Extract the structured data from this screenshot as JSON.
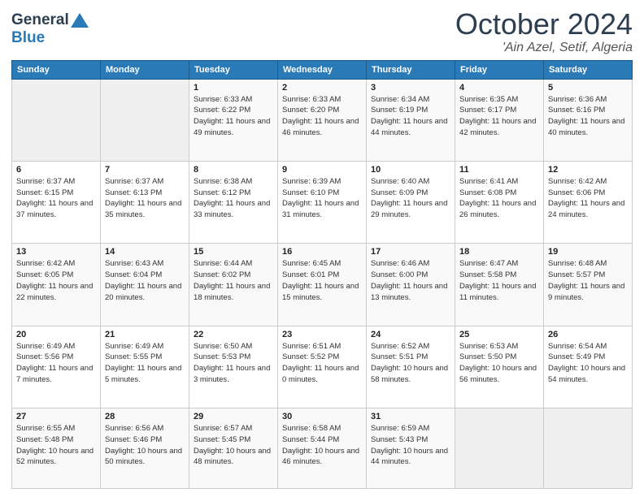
{
  "header": {
    "logo_line1": "General",
    "logo_line2": "Blue",
    "month_title": "October 2024",
    "location": "'Ain Azel, Setif, Algeria"
  },
  "weekdays": [
    "Sunday",
    "Monday",
    "Tuesday",
    "Wednesday",
    "Thursday",
    "Friday",
    "Saturday"
  ],
  "weeks": [
    [
      {
        "day": "",
        "info": ""
      },
      {
        "day": "",
        "info": ""
      },
      {
        "day": "1",
        "info": "Sunrise: 6:33 AM\nSunset: 6:22 PM\nDaylight: 11 hours and 49 minutes."
      },
      {
        "day": "2",
        "info": "Sunrise: 6:33 AM\nSunset: 6:20 PM\nDaylight: 11 hours and 46 minutes."
      },
      {
        "day": "3",
        "info": "Sunrise: 6:34 AM\nSunset: 6:19 PM\nDaylight: 11 hours and 44 minutes."
      },
      {
        "day": "4",
        "info": "Sunrise: 6:35 AM\nSunset: 6:17 PM\nDaylight: 11 hours and 42 minutes."
      },
      {
        "day": "5",
        "info": "Sunrise: 6:36 AM\nSunset: 6:16 PM\nDaylight: 11 hours and 40 minutes."
      }
    ],
    [
      {
        "day": "6",
        "info": "Sunrise: 6:37 AM\nSunset: 6:15 PM\nDaylight: 11 hours and 37 minutes."
      },
      {
        "day": "7",
        "info": "Sunrise: 6:37 AM\nSunset: 6:13 PM\nDaylight: 11 hours and 35 minutes."
      },
      {
        "day": "8",
        "info": "Sunrise: 6:38 AM\nSunset: 6:12 PM\nDaylight: 11 hours and 33 minutes."
      },
      {
        "day": "9",
        "info": "Sunrise: 6:39 AM\nSunset: 6:10 PM\nDaylight: 11 hours and 31 minutes."
      },
      {
        "day": "10",
        "info": "Sunrise: 6:40 AM\nSunset: 6:09 PM\nDaylight: 11 hours and 29 minutes."
      },
      {
        "day": "11",
        "info": "Sunrise: 6:41 AM\nSunset: 6:08 PM\nDaylight: 11 hours and 26 minutes."
      },
      {
        "day": "12",
        "info": "Sunrise: 6:42 AM\nSunset: 6:06 PM\nDaylight: 11 hours and 24 minutes."
      }
    ],
    [
      {
        "day": "13",
        "info": "Sunrise: 6:42 AM\nSunset: 6:05 PM\nDaylight: 11 hours and 22 minutes."
      },
      {
        "day": "14",
        "info": "Sunrise: 6:43 AM\nSunset: 6:04 PM\nDaylight: 11 hours and 20 minutes."
      },
      {
        "day": "15",
        "info": "Sunrise: 6:44 AM\nSunset: 6:02 PM\nDaylight: 11 hours and 18 minutes."
      },
      {
        "day": "16",
        "info": "Sunrise: 6:45 AM\nSunset: 6:01 PM\nDaylight: 11 hours and 15 minutes."
      },
      {
        "day": "17",
        "info": "Sunrise: 6:46 AM\nSunset: 6:00 PM\nDaylight: 11 hours and 13 minutes."
      },
      {
        "day": "18",
        "info": "Sunrise: 6:47 AM\nSunset: 5:58 PM\nDaylight: 11 hours and 11 minutes."
      },
      {
        "day": "19",
        "info": "Sunrise: 6:48 AM\nSunset: 5:57 PM\nDaylight: 11 hours and 9 minutes."
      }
    ],
    [
      {
        "day": "20",
        "info": "Sunrise: 6:49 AM\nSunset: 5:56 PM\nDaylight: 11 hours and 7 minutes."
      },
      {
        "day": "21",
        "info": "Sunrise: 6:49 AM\nSunset: 5:55 PM\nDaylight: 11 hours and 5 minutes."
      },
      {
        "day": "22",
        "info": "Sunrise: 6:50 AM\nSunset: 5:53 PM\nDaylight: 11 hours and 3 minutes."
      },
      {
        "day": "23",
        "info": "Sunrise: 6:51 AM\nSunset: 5:52 PM\nDaylight: 11 hours and 0 minutes."
      },
      {
        "day": "24",
        "info": "Sunrise: 6:52 AM\nSunset: 5:51 PM\nDaylight: 10 hours and 58 minutes."
      },
      {
        "day": "25",
        "info": "Sunrise: 6:53 AM\nSunset: 5:50 PM\nDaylight: 10 hours and 56 minutes."
      },
      {
        "day": "26",
        "info": "Sunrise: 6:54 AM\nSunset: 5:49 PM\nDaylight: 10 hours and 54 minutes."
      }
    ],
    [
      {
        "day": "27",
        "info": "Sunrise: 6:55 AM\nSunset: 5:48 PM\nDaylight: 10 hours and 52 minutes."
      },
      {
        "day": "28",
        "info": "Sunrise: 6:56 AM\nSunset: 5:46 PM\nDaylight: 10 hours and 50 minutes."
      },
      {
        "day": "29",
        "info": "Sunrise: 6:57 AM\nSunset: 5:45 PM\nDaylight: 10 hours and 48 minutes."
      },
      {
        "day": "30",
        "info": "Sunrise: 6:58 AM\nSunset: 5:44 PM\nDaylight: 10 hours and 46 minutes."
      },
      {
        "day": "31",
        "info": "Sunrise: 6:59 AM\nSunset: 5:43 PM\nDaylight: 10 hours and 44 minutes."
      },
      {
        "day": "",
        "info": ""
      },
      {
        "day": "",
        "info": ""
      }
    ]
  ]
}
